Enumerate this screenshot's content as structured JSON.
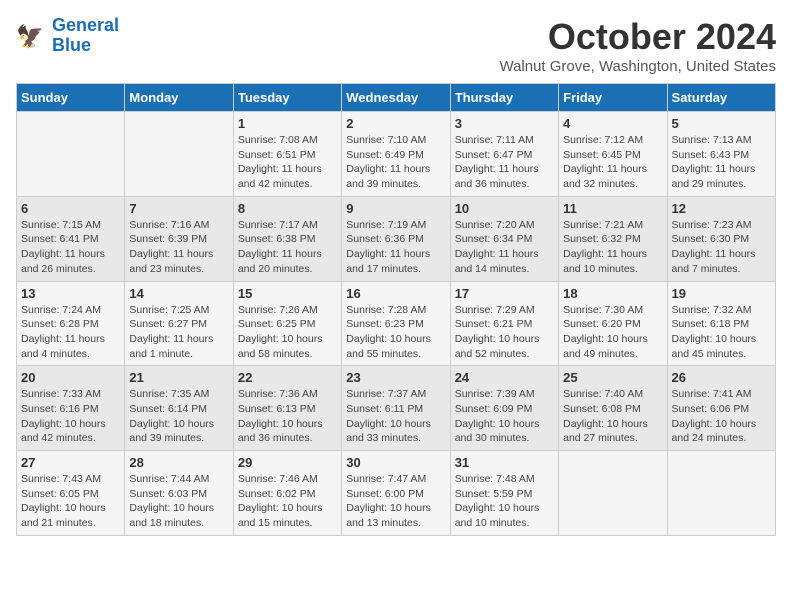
{
  "logo": {
    "line1": "General",
    "line2": "Blue"
  },
  "title": "October 2024",
  "location": "Walnut Grove, Washington, United States",
  "weekdays": [
    "Sunday",
    "Monday",
    "Tuesday",
    "Wednesday",
    "Thursday",
    "Friday",
    "Saturday"
  ],
  "weeks": [
    [
      {
        "day": "",
        "info": ""
      },
      {
        "day": "",
        "info": ""
      },
      {
        "day": "1",
        "info": "Sunrise: 7:08 AM\nSunset: 6:51 PM\nDaylight: 11 hours and 42 minutes."
      },
      {
        "day": "2",
        "info": "Sunrise: 7:10 AM\nSunset: 6:49 PM\nDaylight: 11 hours and 39 minutes."
      },
      {
        "day": "3",
        "info": "Sunrise: 7:11 AM\nSunset: 6:47 PM\nDaylight: 11 hours and 36 minutes."
      },
      {
        "day": "4",
        "info": "Sunrise: 7:12 AM\nSunset: 6:45 PM\nDaylight: 11 hours and 32 minutes."
      },
      {
        "day": "5",
        "info": "Sunrise: 7:13 AM\nSunset: 6:43 PM\nDaylight: 11 hours and 29 minutes."
      }
    ],
    [
      {
        "day": "6",
        "info": "Sunrise: 7:15 AM\nSunset: 6:41 PM\nDaylight: 11 hours and 26 minutes."
      },
      {
        "day": "7",
        "info": "Sunrise: 7:16 AM\nSunset: 6:39 PM\nDaylight: 11 hours and 23 minutes."
      },
      {
        "day": "8",
        "info": "Sunrise: 7:17 AM\nSunset: 6:38 PM\nDaylight: 11 hours and 20 minutes."
      },
      {
        "day": "9",
        "info": "Sunrise: 7:19 AM\nSunset: 6:36 PM\nDaylight: 11 hours and 17 minutes."
      },
      {
        "day": "10",
        "info": "Sunrise: 7:20 AM\nSunset: 6:34 PM\nDaylight: 11 hours and 14 minutes."
      },
      {
        "day": "11",
        "info": "Sunrise: 7:21 AM\nSunset: 6:32 PM\nDaylight: 11 hours and 10 minutes."
      },
      {
        "day": "12",
        "info": "Sunrise: 7:23 AM\nSunset: 6:30 PM\nDaylight: 11 hours and 7 minutes."
      }
    ],
    [
      {
        "day": "13",
        "info": "Sunrise: 7:24 AM\nSunset: 6:28 PM\nDaylight: 11 hours and 4 minutes."
      },
      {
        "day": "14",
        "info": "Sunrise: 7:25 AM\nSunset: 6:27 PM\nDaylight: 11 hours and 1 minute."
      },
      {
        "day": "15",
        "info": "Sunrise: 7:26 AM\nSunset: 6:25 PM\nDaylight: 10 hours and 58 minutes."
      },
      {
        "day": "16",
        "info": "Sunrise: 7:28 AM\nSunset: 6:23 PM\nDaylight: 10 hours and 55 minutes."
      },
      {
        "day": "17",
        "info": "Sunrise: 7:29 AM\nSunset: 6:21 PM\nDaylight: 10 hours and 52 minutes."
      },
      {
        "day": "18",
        "info": "Sunrise: 7:30 AM\nSunset: 6:20 PM\nDaylight: 10 hours and 49 minutes."
      },
      {
        "day": "19",
        "info": "Sunrise: 7:32 AM\nSunset: 6:18 PM\nDaylight: 10 hours and 45 minutes."
      }
    ],
    [
      {
        "day": "20",
        "info": "Sunrise: 7:33 AM\nSunset: 6:16 PM\nDaylight: 10 hours and 42 minutes."
      },
      {
        "day": "21",
        "info": "Sunrise: 7:35 AM\nSunset: 6:14 PM\nDaylight: 10 hours and 39 minutes."
      },
      {
        "day": "22",
        "info": "Sunrise: 7:36 AM\nSunset: 6:13 PM\nDaylight: 10 hours and 36 minutes."
      },
      {
        "day": "23",
        "info": "Sunrise: 7:37 AM\nSunset: 6:11 PM\nDaylight: 10 hours and 33 minutes."
      },
      {
        "day": "24",
        "info": "Sunrise: 7:39 AM\nSunset: 6:09 PM\nDaylight: 10 hours and 30 minutes."
      },
      {
        "day": "25",
        "info": "Sunrise: 7:40 AM\nSunset: 6:08 PM\nDaylight: 10 hours and 27 minutes."
      },
      {
        "day": "26",
        "info": "Sunrise: 7:41 AM\nSunset: 6:06 PM\nDaylight: 10 hours and 24 minutes."
      }
    ],
    [
      {
        "day": "27",
        "info": "Sunrise: 7:43 AM\nSunset: 6:05 PM\nDaylight: 10 hours and 21 minutes."
      },
      {
        "day": "28",
        "info": "Sunrise: 7:44 AM\nSunset: 6:03 PM\nDaylight: 10 hours and 18 minutes."
      },
      {
        "day": "29",
        "info": "Sunrise: 7:46 AM\nSunset: 6:02 PM\nDaylight: 10 hours and 15 minutes."
      },
      {
        "day": "30",
        "info": "Sunrise: 7:47 AM\nSunset: 6:00 PM\nDaylight: 10 hours and 13 minutes."
      },
      {
        "day": "31",
        "info": "Sunrise: 7:48 AM\nSunset: 5:59 PM\nDaylight: 10 hours and 10 minutes."
      },
      {
        "day": "",
        "info": ""
      },
      {
        "day": "",
        "info": ""
      }
    ]
  ]
}
